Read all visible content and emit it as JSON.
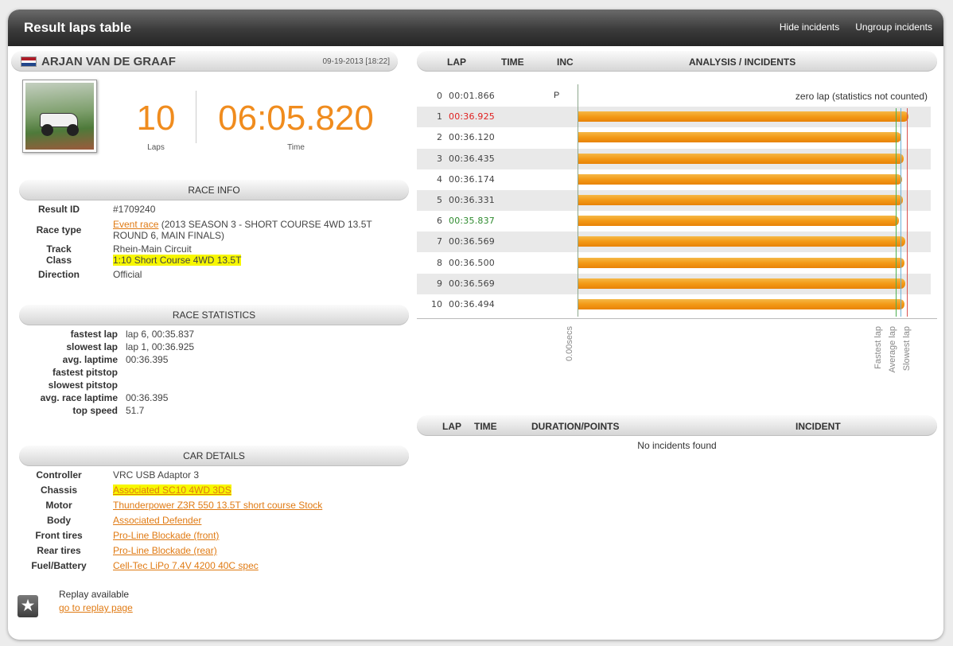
{
  "header": {
    "title": "Result laps table",
    "hide_incidents": "Hide incidents",
    "ungroup_incidents": "Ungroup incidents"
  },
  "driver": {
    "name": "ARJAN VAN DE GRAAF",
    "date": "09-19-2013 [18:22]",
    "flag_colors": [
      "#ae1c28",
      "#ffffff",
      "#21468b"
    ],
    "laps_value": "10",
    "laps_label": "Laps",
    "time_value": "06:05.820",
    "time_label": "Time"
  },
  "race_info": {
    "title": "RACE INFO",
    "result_id_label": "Result ID",
    "result_id": "#1709240",
    "race_type_label": "Race type",
    "race_type_link": "Event race",
    "race_type_rest": "(2013 SEASON 3 - SHORT COURSE 4WD 13.5T ROUND 6, MAIN FINALS)",
    "track_label": "Track",
    "track": "Rhein-Main Circuit",
    "class_label": "Class",
    "class": "1:10 Short Course 4WD 13.5T",
    "direction_label": "Direction",
    "direction": "Official"
  },
  "race_stats": {
    "title": "RACE STATISTICS",
    "rows": [
      {
        "label": "fastest lap",
        "value": "lap 6, 00:35.837"
      },
      {
        "label": "slowest lap",
        "value": "lap 1, 00:36.925"
      },
      {
        "label": "avg. laptime",
        "value": "00:36.395"
      },
      {
        "label": "fastest pitstop",
        "value": ""
      },
      {
        "label": "slowest pitstop",
        "value": ""
      },
      {
        "label": "avg. race laptime",
        "value": "00:36.395"
      },
      {
        "label": "top speed",
        "value": "51.7"
      }
    ]
  },
  "car_details": {
    "title": "CAR DETAILS",
    "rows": [
      {
        "label": "Controller",
        "value": "VRC USB Adaptor 3"
      },
      {
        "label": "Chassis",
        "value": "Associated SC10 4WD 3DS"
      },
      {
        "label": "Motor",
        "value": "Thunderpower Z3R 550 13.5T short course Stock"
      },
      {
        "label": "Body",
        "value": "Associated Defender"
      },
      {
        "label": "Front tires",
        "value": "Pro-Line Blockade (front)"
      },
      {
        "label": "Rear tires",
        "value": "Pro-Line Blockade (rear)"
      },
      {
        "label": "Fuel/Battery",
        "value": "Cell-Tec LiPo 7.4V 4200 40C spec"
      }
    ]
  },
  "replay": {
    "text": "Replay available",
    "link": "go to replay page"
  },
  "laps_table": {
    "col_lap": "LAP",
    "col_time": "TIME",
    "col_inc": "INC",
    "col_analysis": "ANALYSIS / INCIDENTS",
    "zero_note": "zero lap (statistics not counted)",
    "laps": [
      {
        "lap": "0",
        "time": "00:01.866",
        "inc": "P",
        "seconds": 1.866
      },
      {
        "lap": "1",
        "time": "00:36.925",
        "inc": "",
        "seconds": 36.925
      },
      {
        "lap": "2",
        "time": "00:36.120",
        "inc": "",
        "seconds": 36.12
      },
      {
        "lap": "3",
        "time": "00:36.435",
        "inc": "",
        "seconds": 36.435
      },
      {
        "lap": "4",
        "time": "00:36.174",
        "inc": "",
        "seconds": 36.174
      },
      {
        "lap": "5",
        "time": "00:36.331",
        "inc": "",
        "seconds": 36.331
      },
      {
        "lap": "6",
        "time": "00:35.837",
        "inc": "",
        "seconds": 35.837
      },
      {
        "lap": "7",
        "time": "00:36.569",
        "inc": "",
        "seconds": 36.569
      },
      {
        "lap": "8",
        "time": "00:36.500",
        "inc": "",
        "seconds": 36.5
      },
      {
        "lap": "9",
        "time": "00:36.569",
        "inc": "",
        "seconds": 36.569
      },
      {
        "lap": "10",
        "time": "00:36.494",
        "inc": "",
        "seconds": 36.494
      }
    ],
    "axis_zero_label": "0.00secs",
    "fastest_label": "Fastest lap",
    "average_label": "Average lap",
    "slowest_label": "Slowest lap",
    "colors": {
      "fastest": "#2e8b2e",
      "slowest": "#e02020",
      "bar": "#f39a16"
    }
  },
  "incidents_table": {
    "col_lap": "LAP",
    "col_time": "TIME",
    "col_duration": "DURATION/POINTS",
    "col_incident": "INCIDENT",
    "empty": "No incidents found"
  }
}
